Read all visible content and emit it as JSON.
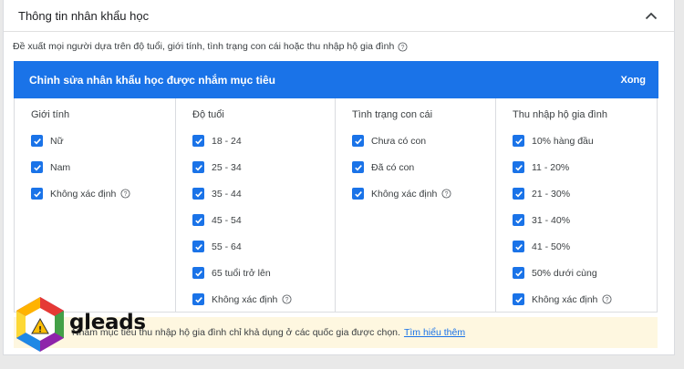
{
  "panel": {
    "title": "Thông tin nhân khẩu học",
    "description": "Đề xuất mọi người dựa trên độ tuổi, giới tính, tình trạng con cái hoặc thu nhập hộ gia đình",
    "collapse_icon": "chevron-up-icon"
  },
  "editor": {
    "title": "Chỉnh sửa nhân khẩu học được nhắm mục tiêu",
    "done_label": "Xong",
    "accent_color": "#1a73e8"
  },
  "columns": [
    {
      "heading": "Giới tính",
      "options": [
        {
          "label": "Nữ",
          "checked": true,
          "help": false
        },
        {
          "label": "Nam",
          "checked": true,
          "help": false
        },
        {
          "label": "Không xác định",
          "checked": true,
          "help": true
        }
      ]
    },
    {
      "heading": "Độ tuổi",
      "options": [
        {
          "label": "18 - 24",
          "checked": true,
          "help": false
        },
        {
          "label": "25 - 34",
          "checked": true,
          "help": false
        },
        {
          "label": "35 - 44",
          "checked": true,
          "help": false
        },
        {
          "label": "45 - 54",
          "checked": true,
          "help": false
        },
        {
          "label": "55 - 64",
          "checked": true,
          "help": false
        },
        {
          "label": "65 tuổi trở lên",
          "checked": true,
          "help": false
        },
        {
          "label": "Không xác định",
          "checked": true,
          "help": true
        }
      ]
    },
    {
      "heading": "Tình trạng con cái",
      "options": [
        {
          "label": "Chưa có con",
          "checked": true,
          "help": false
        },
        {
          "label": "Đã có con",
          "checked": true,
          "help": false
        },
        {
          "label": "Không xác định",
          "checked": true,
          "help": true
        }
      ]
    },
    {
      "heading": "Thu nhập hộ gia đình",
      "options": [
        {
          "label": "10% hàng đầu",
          "checked": true,
          "help": false
        },
        {
          "label": "11 - 20%",
          "checked": true,
          "help": false
        },
        {
          "label": "21 - 30%",
          "checked": true,
          "help": false
        },
        {
          "label": "31 - 40%",
          "checked": true,
          "help": false
        },
        {
          "label": "41 - 50%",
          "checked": true,
          "help": false
        },
        {
          "label": "50% dưới cùng",
          "checked": true,
          "help": false
        },
        {
          "label": "Không xác định",
          "checked": true,
          "help": true
        }
      ]
    }
  ],
  "notice": {
    "text": "Nhắm mục tiêu thu nhập hộ gia đình chỉ khả dụng ở các quốc gia được chọn.",
    "link": "Tìm hiểu thêm",
    "icon": "warning-icon",
    "background": "#fef7e0"
  },
  "watermark": {
    "text": "gleads"
  }
}
